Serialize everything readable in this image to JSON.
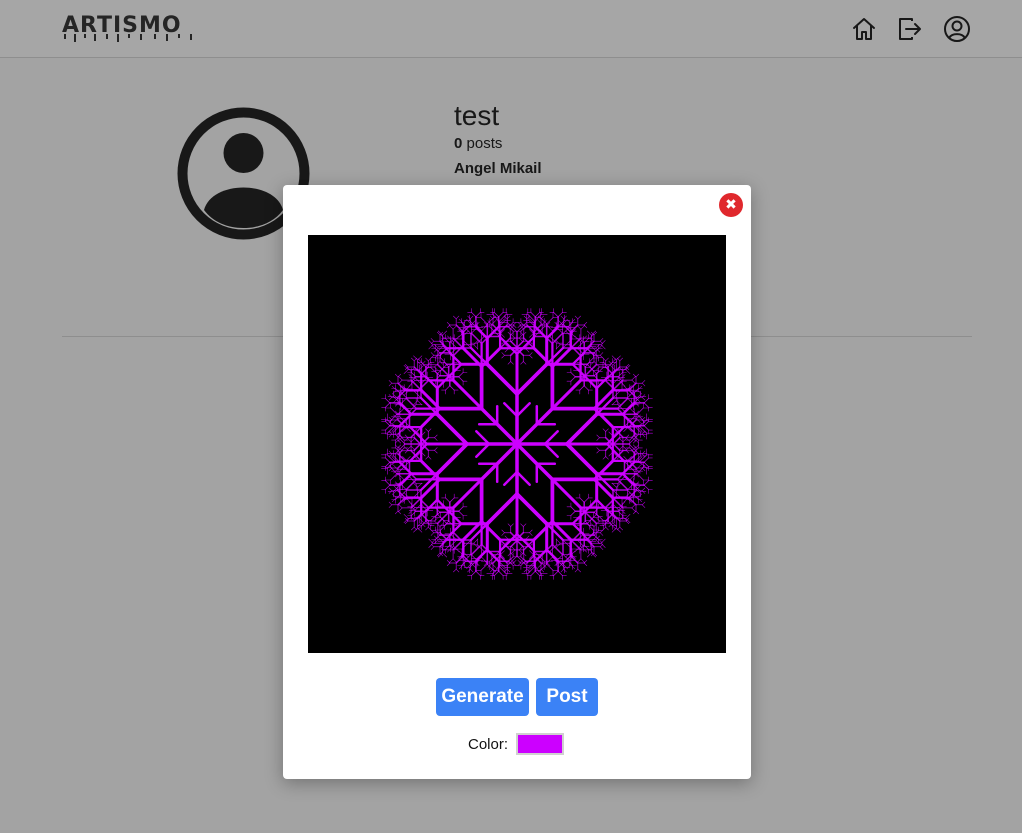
{
  "app": {
    "logo": "ARTISMO"
  },
  "nav": {
    "home_icon": "home-icon",
    "logout_icon": "logout-icon",
    "account_icon": "user-circle-icon"
  },
  "profile": {
    "username": "test",
    "post_count": "0",
    "posts_label": "posts",
    "full_name": "Angel Mikail"
  },
  "modal": {
    "close_icon": "close-icon",
    "generate_label": "Generate",
    "post_label": "Post",
    "color_label": "Color:",
    "color_value": "#cc00ff"
  }
}
